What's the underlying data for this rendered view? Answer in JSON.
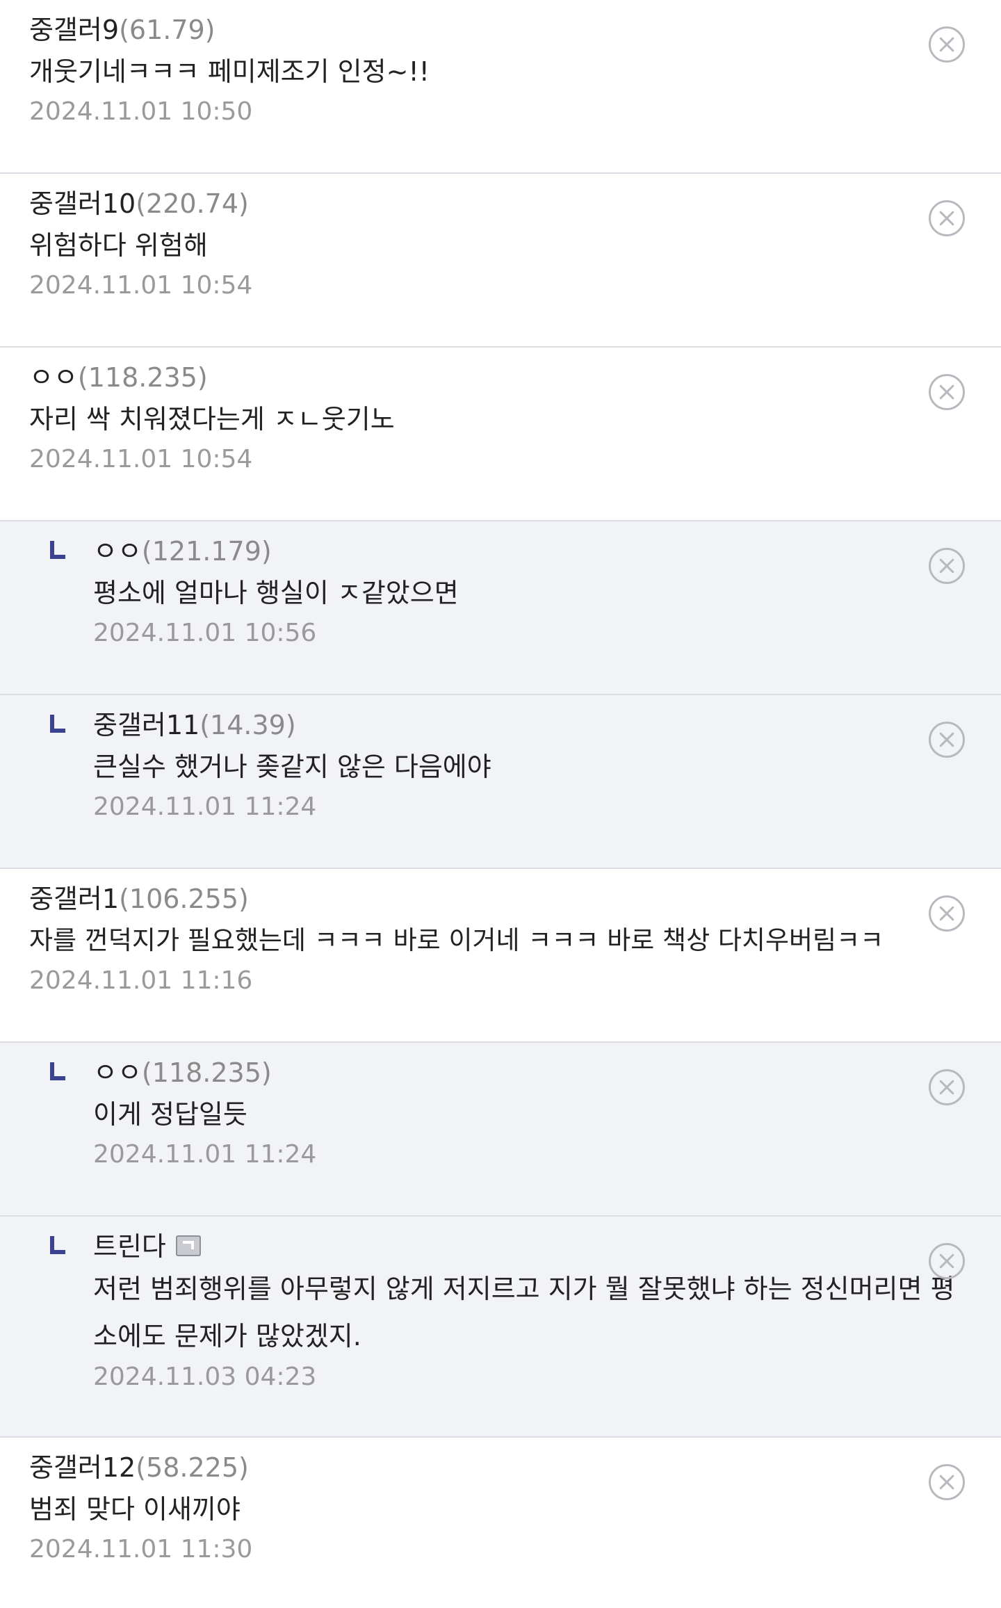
{
  "comments": [
    {
      "nick": "중갤러9",
      "ip": "(61.79)",
      "text": "개웃기네ㅋㅋㅋ 페미제조기 인정~!!",
      "date": "2024.11.01 10:50",
      "reply": false
    },
    {
      "nick": "중갤러10",
      "ip": "(220.74)",
      "text": "위험하다 위험해",
      "date": "2024.11.01 10:54",
      "reply": false
    },
    {
      "nick": "ㅇㅇ",
      "ip": "(118.235)",
      "text": "자리 싹 치워졌다는게 ㅈㄴ웃기노",
      "date": "2024.11.01 10:54",
      "reply": false
    },
    {
      "nick": "ㅇㅇ",
      "ip": "(121.179)",
      "text": "평소에 얼마나 행실이 ㅈ같았으면",
      "date": "2024.11.01 10:56",
      "reply": true
    },
    {
      "nick": "중갤러11",
      "ip": "(14.39)",
      "text": "큰실수 했거나 좆같지 않은 다음에야",
      "date": "2024.11.01 11:24",
      "reply": true
    },
    {
      "nick": "중갤러1",
      "ip": "(106.255)",
      "text": "자를 껀덕지가 필요했는데 ㅋㅋㅋ 바로 이거네 ㅋㅋㅋ 바로 책상 다치우버림ㅋㅋ",
      "date": "2024.11.01 11:16",
      "reply": false
    },
    {
      "nick": "ㅇㅇ",
      "ip": "(118.235)",
      "text": "이게 정답일듯",
      "date": "2024.11.01 11:24",
      "reply": true
    },
    {
      "nick": "트린다",
      "ip": "",
      "badge": "gallog-badge-icon",
      "text": "저런 범죄행위를 아무렇지 않게 저지르고 지가 뭘 잘못했냐 하는 정신머리면 평소에도 문제가 많았겠지.",
      "date": "2024.11.03 04:23",
      "reply": true,
      "tall": true
    },
    {
      "nick": "중갤러12",
      "ip": "(58.225)",
      "text": "범죄 맞다 이새끼야",
      "date": "2024.11.01 11:30",
      "reply": false
    }
  ],
  "colors": {
    "reply_bg": "#f1f3f7",
    "reply_mark": "#3b4390",
    "divider": "#dcdde3",
    "ip": "#8a8a8a",
    "date": "#9a9a9a",
    "delete_icon": "#b8b9bf"
  },
  "icons": {
    "reply": "reply-arrow-icon",
    "delete": "delete-circle-x-icon"
  }
}
